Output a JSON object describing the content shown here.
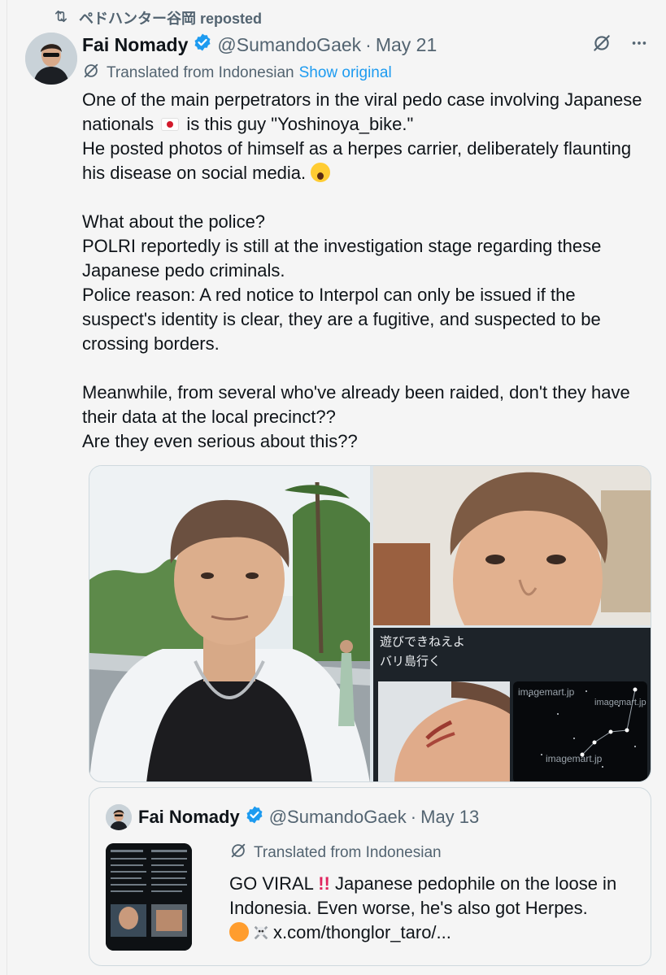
{
  "repost": {
    "text": "ペドハンター谷岡 reposted"
  },
  "tweet": {
    "author_name": "Fai Nomady",
    "handle": "@SumandoGaek",
    "separator": "·",
    "date": "May 21",
    "translated_label": "Translated from Indonesian",
    "show_original": "Show original",
    "para1_a": "One of the main perpetrators in the viral pedo case involving Japanese nationals",
    "para1_b": "is this guy \"Yoshinoya_bike.\"\nHe posted photos of himself as a herpes carrier, deliberately flaunting his disease on social media.",
    "para2": "What about the police?\nPOLRI reportedly is still at the investigation stage regarding these Japanese pedo criminals.\nPolice reason: A red notice to Interpol can only be issued if the suspect's identity is clear, they are a fugitive, and suspected to be crossing borders.",
    "para3": "Meanwhile, from several who've already been raided, don't they have their data at the local precinct??\nAre they even serious about this??"
  },
  "media": {
    "caption_line1": "遊びできねえよ",
    "caption_line2": "バリ島行く",
    "watermark": "imagemart.jp"
  },
  "quote": {
    "author_name": "Fai Nomady",
    "handle": "@SumandoGaek",
    "separator": "·",
    "date": "May 13",
    "translated_label": "Translated from Indonesian",
    "text_a": "GO VIRAL",
    "text_b": "Japanese pedophile on the loose in Indonesia. Even worse, he's also got Herpes.",
    "link": "x.com/thonglor_taro/..."
  },
  "colors": {
    "link": "#1d9bf0",
    "muted": "#536471",
    "verified": "#1d9bf0"
  },
  "icons": [
    "repost-icon",
    "verified-badge-icon",
    "grok-icon",
    "more-icon",
    "translate-icon"
  ]
}
